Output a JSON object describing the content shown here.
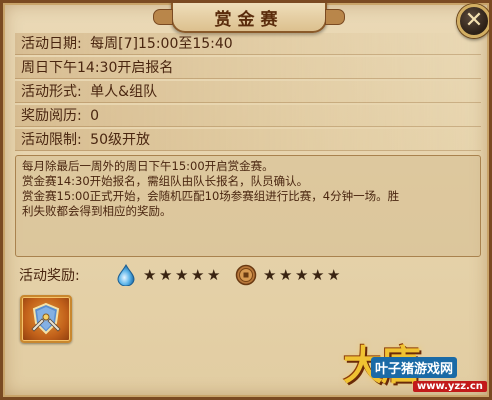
{
  "window": {
    "title": "赏金赛",
    "close_label": "✕"
  },
  "info": [
    {
      "label": "活动日期:",
      "value": "每周[7]15:00至15:40"
    },
    {
      "label": "",
      "value": "周日下午14:30开启报名"
    },
    {
      "label": "活动形式:",
      "value": "单人&组队"
    },
    {
      "label": "奖励阅历:",
      "value": "0"
    },
    {
      "label": "活动限制:",
      "value": "50级开放"
    }
  ],
  "description": [
    "每月除最后一周外的周日下午15:00开启赏金赛。",
    "赏金赛14:30开始报名，需组队由队长报名，队员确认。",
    "赏金赛15:00正式开始，会随机匹配10场参赛组进行比赛，4分钟一场。胜",
    "利失败都会得到相应的奖励。"
  ],
  "reward": {
    "label": "活动奖励:",
    "items": [
      {
        "icon": "water-drop-icon",
        "stars": 5,
        "star_glyph": "★"
      },
      {
        "icon": "copper-coin-icon",
        "stars": 5,
        "star_glyph": "★"
      }
    ],
    "slot_icon": "sword-shield-emblem-icon"
  },
  "watermark": {
    "brand": "大唐",
    "site": "叶子猪游戏网",
    "url": "www.yzz.cn"
  },
  "colors": {
    "panel_bg": "#e6d3ab",
    "frame": "#7a4a22",
    "text": "#4a2610",
    "item_slot": "#c2611a"
  }
}
